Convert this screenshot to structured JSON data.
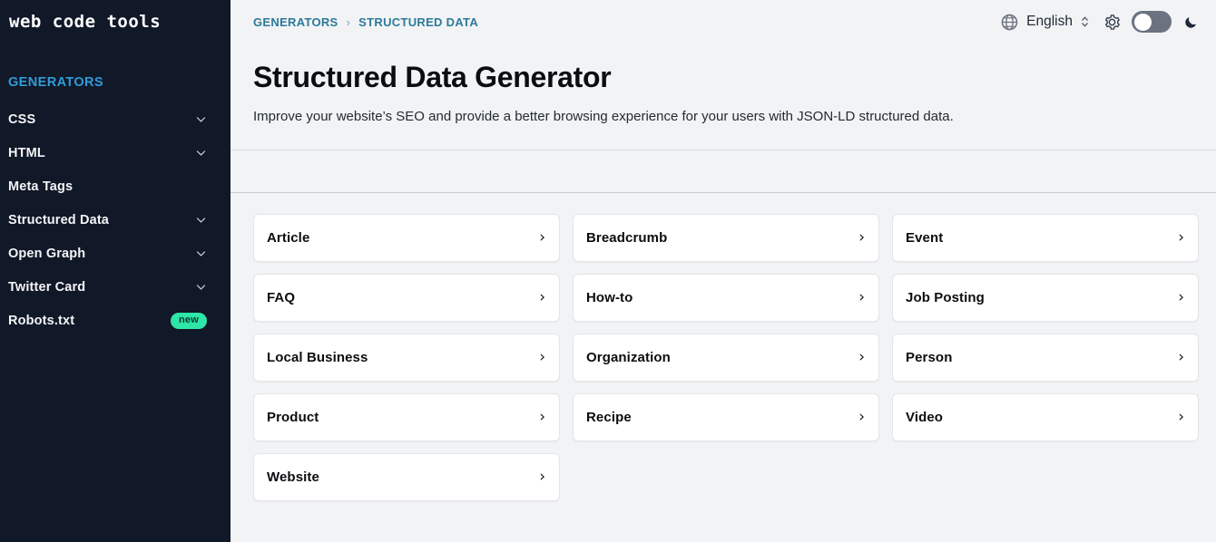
{
  "sidebar": {
    "brand": "web code tools",
    "heading": "GENERATORS",
    "items": [
      {
        "label": "CSS",
        "icon": "chevron-down-icon",
        "has_chevron": true,
        "badge": null
      },
      {
        "label": "HTML",
        "icon": "chevron-down-icon",
        "has_chevron": true,
        "badge": null
      },
      {
        "label": "Meta Tags",
        "icon": null,
        "has_chevron": false,
        "badge": null
      },
      {
        "label": "Structured Data",
        "icon": "chevron-down-icon",
        "has_chevron": true,
        "badge": null
      },
      {
        "label": "Open Graph",
        "icon": "chevron-down-icon",
        "has_chevron": true,
        "badge": null
      },
      {
        "label": "Twitter Card",
        "icon": "chevron-down-icon",
        "has_chevron": true,
        "badge": null
      },
      {
        "label": "Robots.txt",
        "icon": null,
        "has_chevron": false,
        "badge": "new"
      }
    ]
  },
  "topbar": {
    "breadcrumb": [
      "GENERATORS",
      "STRUCTURED DATA"
    ],
    "breadcrumb_separator": "›",
    "language": {
      "icon": "globe-icon",
      "value": "English",
      "selector_icon": "up-down-chevron-icon"
    },
    "settings_icon": "gear-icon",
    "theme_toggle": {
      "state": "off",
      "moon_icon": "moon-icon"
    }
  },
  "hero": {
    "title": "Structured Data Generator",
    "subtitle": "Improve your website’s SEO and provide a better browsing experience for your users with JSON-LD structured data."
  },
  "cards": {
    "chevron": "›",
    "items": [
      {
        "label": "Article"
      },
      {
        "label": "Breadcrumb"
      },
      {
        "label": "Event"
      },
      {
        "label": "FAQ"
      },
      {
        "label": "How-to"
      },
      {
        "label": "Job Posting"
      },
      {
        "label": "Local Business"
      },
      {
        "label": "Organization"
      },
      {
        "label": "Person"
      },
      {
        "label": "Product"
      },
      {
        "label": "Recipe"
      },
      {
        "label": "Video"
      },
      {
        "label": "Website"
      }
    ]
  },
  "colors": {
    "sidebar_bg": "#111827",
    "sidebar_heading": "#2f9cd8",
    "badge_bg": "#2ee6a8",
    "breadcrumb": "#2c7a99",
    "page_bg": "#f2f3f5",
    "card_bg": "#ffffff",
    "toggle_track": "#6b7280"
  }
}
